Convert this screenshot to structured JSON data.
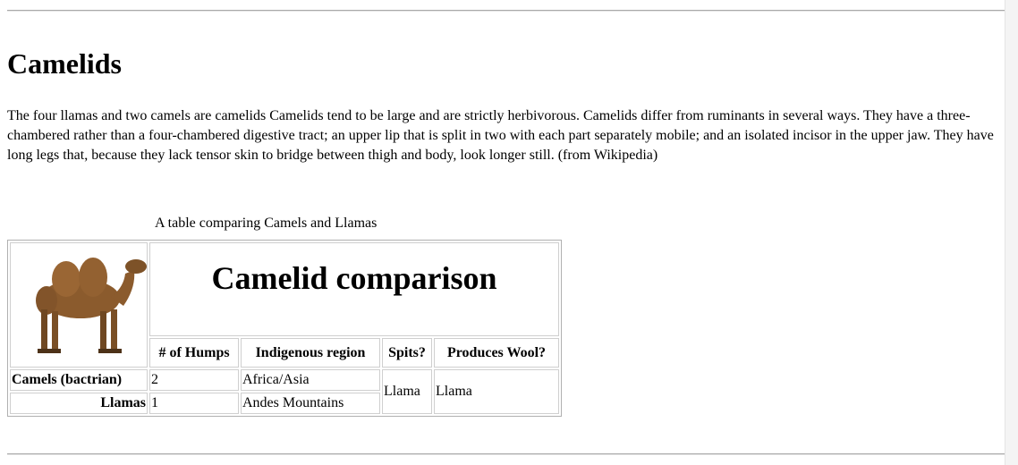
{
  "page": {
    "heading": "Camelids",
    "intro": "The four llamas and two camels are camelids Camelids tend to be large and are strictly herbivorous. Camelids differ from ruminants in several ways. They have a three-chambered rather than a four-chambered digestive tract; an upper lip that is split in two with each part separately mobile; and an isolated incisor in the upper jaw. They have long legs that, because they lack tensor skin to bridge between thigh and body, look longer still. (from Wikipedia)"
  },
  "table": {
    "caption": "A table comparing Camels and Llamas",
    "title": "Camelid comparison",
    "image": "camel-photo",
    "columns": [
      "# of Humps",
      "Indigenous region",
      "Spits?",
      "Produces Wool?"
    ],
    "rows": [
      {
        "label": "Camels (bactrian)",
        "humps": "2",
        "region": "Africa/Asia"
      },
      {
        "label": "Llamas",
        "humps": "1",
        "region": "Andes Mountains"
      }
    ],
    "shared": {
      "spits": "Llama",
      "wool": "Llama"
    }
  }
}
